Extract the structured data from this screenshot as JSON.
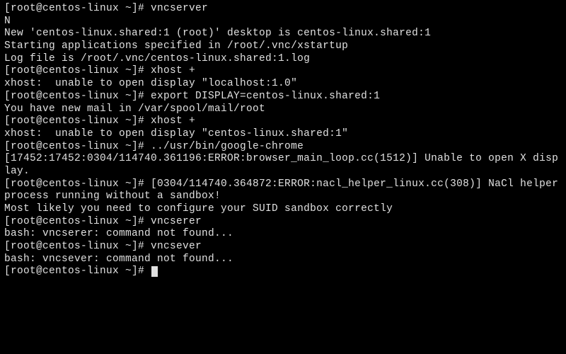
{
  "lines": [
    "[root@centos-linux ~]# vncserver",
    "N",
    "New 'centos-linux.shared:1 (root)' desktop is centos-linux.shared:1",
    "",
    "Starting applications specified in /root/.vnc/xstartup",
    "Log file is /root/.vnc/centos-linux.shared:1.log",
    "",
    "[root@centos-linux ~]# xhost +",
    "xhost:  unable to open display \"localhost:1.0\"",
    "[root@centos-linux ~]# export DISPLAY=centos-linux.shared:1",
    "You have new mail in /var/spool/mail/root",
    "[root@centos-linux ~]# xhost +",
    "xhost:  unable to open display \"centos-linux.shared:1\"",
    "[root@centos-linux ~]# ../usr/bin/google-chrome",
    "[17452:17452:0304/114740.361196:ERROR:browser_main_loop.cc(1512)] Unable to open X display.",
    "[root@centos-linux ~]# [0304/114740.364872:ERROR:nacl_helper_linux.cc(308)] NaCl helper process running without a sandbox!",
    "Most likely you need to configure your SUID sandbox correctly",
    "",
    "[root@centos-linux ~]# vncserer",
    "bash: vncserer: command not found...",
    "[root@centos-linux ~]# vncsever",
    "bash: vncsever: command not found...",
    "[root@centos-linux ~]# "
  ]
}
